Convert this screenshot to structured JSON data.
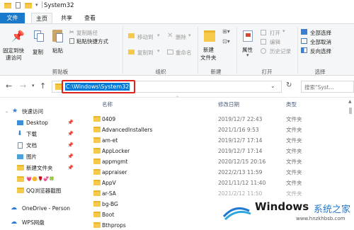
{
  "window": {
    "title": "System32"
  },
  "tabs": {
    "file": "文件",
    "home": "主页",
    "share": "共享",
    "view": "查看"
  },
  "ribbon": {
    "pin_quick_access": [
      "固定到快",
      "速访问"
    ],
    "copy": "复制",
    "paste": "粘贴",
    "copy_path": "复制路径",
    "paste_shortcut": "粘贴快捷方式",
    "clipboard_group": "剪贴板",
    "move_to": "移动到",
    "copy_to": "复制到",
    "delete": "删除",
    "rename": "重命名",
    "organize_group": "组织",
    "new_folder": [
      "新建",
      "文件夹"
    ],
    "new_group": "新建",
    "properties": "属性",
    "open": "打开",
    "edit": "编辑",
    "history": "历史记录",
    "open_group": "打开",
    "select_all": "全部选择",
    "select_none": "全部取消",
    "invert_selection": "反向选择",
    "select_group": "选择"
  },
  "address": {
    "path": "C:\\Windows\\System32",
    "search_placeholder": "搜索\"Syst..."
  },
  "nav_pane": {
    "quick_access": "快速访问",
    "items": [
      "Desktop",
      "下载",
      "文档",
      "图片",
      "新建文件夹",
      "💗🌼🌹💞🍀",
      "QQ浏览器截图"
    ],
    "onedrive": "OneDrive - Person",
    "wps": "WPS网盘"
  },
  "columns": {
    "name": "名称",
    "modified": "修改日期",
    "type": "类型"
  },
  "files": [
    {
      "name": "0409",
      "date": "2019/12/7 22:43",
      "type": "文件夹"
    },
    {
      "name": "AdvancedInstallers",
      "date": "2021/1/16 9:53",
      "type": "文件夹"
    },
    {
      "name": "am-et",
      "date": "2019/12/7 17:14",
      "type": "文件夹"
    },
    {
      "name": "AppLocker",
      "date": "2019/12/7 17:14",
      "type": "文件夹"
    },
    {
      "name": "appmgmt",
      "date": "2020/12/15 20:16",
      "type": "文件夹"
    },
    {
      "name": "appraiser",
      "date": "2022/2/13 11:59",
      "type": "文件夹"
    },
    {
      "name": "AppV",
      "date": "2021/11/12 11:40",
      "type": "文件夹"
    },
    {
      "name": "ar-SA",
      "date": "2021/2/12 11:50",
      "type": "文件夹"
    },
    {
      "name": "bg-BG",
      "date": "",
      "type": ""
    },
    {
      "name": "Boot",
      "date": "",
      "type": ""
    },
    {
      "name": "Bthprops",
      "date": "",
      "type": ""
    }
  ],
  "watermark": {
    "brand": "Windows",
    "cn": "系统之家",
    "url": "www.hnzkhbsb.com"
  },
  "colors": {
    "accent": "#1979ca",
    "highlight": "#e0211c",
    "folder": "#f6c94a"
  }
}
